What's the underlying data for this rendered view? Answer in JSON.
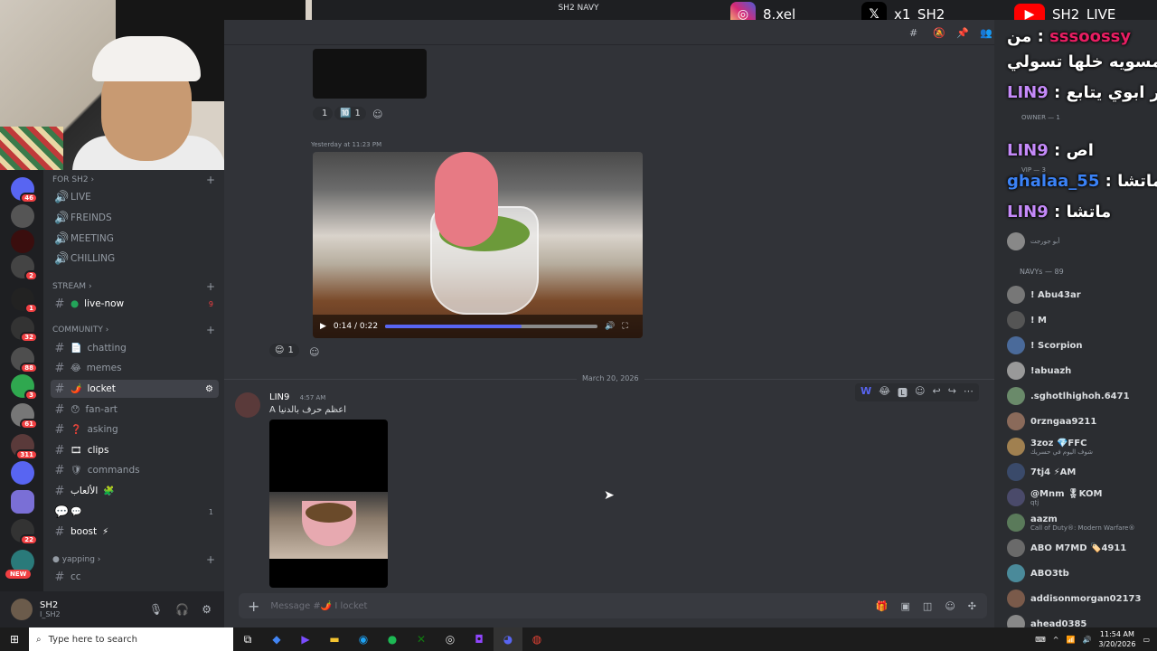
{
  "window": {
    "title": "SH2 NAVY"
  },
  "socials": [
    {
      "platform": "instagram",
      "handle": "8.xel",
      "color": "#d62976"
    },
    {
      "platform": "x",
      "handle": "x1_SH2",
      "color": "#000000"
    },
    {
      "platform": "youtube",
      "handle": "SH2_LIVE",
      "color": "#ff0000"
    }
  ],
  "rail": {
    "badges": [
      "46",
      "2",
      "1",
      "32",
      "88",
      "3",
      "61",
      "311",
      "22"
    ],
    "new_label": "NEW"
  },
  "channels": {
    "server_category": "FOR SH2",
    "voice": [
      "LIVE",
      "FREINDS",
      "MEETING",
      "CHILLING"
    ],
    "stream_category": "STREAM",
    "stream_channel": {
      "name": "live-now",
      "count": "9"
    },
    "community_category": "COMMUNITY",
    "text": [
      {
        "name": "chatting",
        "emoji": "📄"
      },
      {
        "name": "memes",
        "emoji": "😂"
      },
      {
        "name": "locket",
        "emoji": "🌶️"
      },
      {
        "name": "fan-art",
        "emoji": "😯"
      },
      {
        "name": "asking",
        "emoji": "❓"
      },
      {
        "name": "clips",
        "emoji": "🎞"
      },
      {
        "name": "commands",
        "emoji": "🛡"
      },
      {
        "name": "الألعاب",
        "emoji": "🧩"
      },
      {
        "name": "",
        "emoji": "💬",
        "count": "1"
      },
      {
        "name": "boost",
        "emoji": "⚡"
      }
    ],
    "yapping_category": "yapping",
    "yapping_channel": "cc"
  },
  "user": {
    "name": "SH2",
    "status": "I_SH2"
  },
  "chat": {
    "top_reactions": [
      {
        "emoji": "",
        "count": "1"
      },
      {
        "emoji": "🔟",
        "count": "1"
      }
    ],
    "timestamp_prev": "Yesterday at 11:23 PM",
    "video": {
      "current": "0:14",
      "duration": "0:22",
      "progress": 0.64
    },
    "video_reaction": {
      "emoji": "😌",
      "count": "1"
    },
    "date_divider": "March 20, 2026",
    "message": {
      "author": "LIN9",
      "time": "4:57 AM",
      "text": "A اعظم حرف بالدنيا"
    },
    "input_placeholder": "Message #🌶️ I locket"
  },
  "overlay_chat": [
    {
      "user": "sssoossy",
      "text": "من : ",
      "line2": "مسويه خلها تسولي"
    },
    {
      "user": "LIN9",
      "text": "يا حمار ابوي يتابع"
    },
    {
      "user": "LIN9",
      "text": "اص"
    },
    {
      "user": "ghalaa_55",
      "text": "ماتشا"
    },
    {
      "user": "LIN9",
      "text": "ماتشا"
    }
  ],
  "members": {
    "owner_label": "OWNER — 1",
    "vip_label": "VIP — 3",
    "navys_label": "NAVYs — 89",
    "list": [
      {
        "name": "! Abu43ar",
        "sub": ""
      },
      {
        "name": "! M",
        "sub": ""
      },
      {
        "name": "! Scorpion",
        "sub": ""
      },
      {
        "name": "!abuazh",
        "sub": ""
      },
      {
        "name": ".sghotlhighoh.6471",
        "sub": ""
      },
      {
        "name": "0rzngaa9211",
        "sub": ""
      },
      {
        "name": "3zoz 💎FFC",
        "sub": "شوف اليوم في حسريك"
      },
      {
        "name": "7tj4 ⚡AM",
        "sub": ""
      },
      {
        "name": "@Mnm 🎖KOM",
        "sub": "qtj"
      },
      {
        "name": "aazm",
        "sub": "Call of Duty®: Modern Warfare®"
      },
      {
        "name": "ABO M7MD 🏷️4911",
        "sub": ""
      },
      {
        "name": "ABO3tb",
        "sub": ""
      },
      {
        "name": "addisonmorgan02173",
        "sub": ""
      },
      {
        "name": "ahead0385",
        "sub": ""
      }
    ],
    "vip_status": "أبو جورجت"
  },
  "taskbar": {
    "search_placeholder": "Type here to search",
    "time": "11:54 AM",
    "date": "3/20/2026"
  }
}
